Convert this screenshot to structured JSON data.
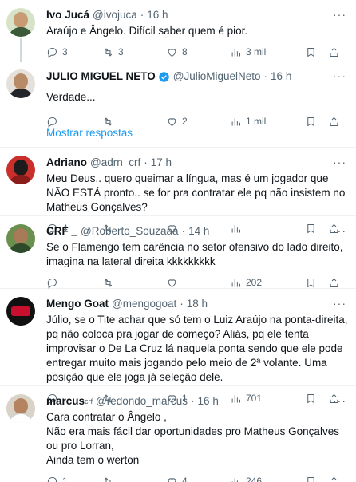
{
  "tweets": [
    {
      "name": "Ivo Jucá",
      "handle": "@ivojuca",
      "time": "16 h",
      "text": [
        "Araújo e Ângelo. Difícil saber quem é pior."
      ],
      "replies": "3",
      "retweets": "3",
      "likes": "8",
      "views": "3 mil"
    },
    {
      "name": "JULIO MIGUEL NETO",
      "handle": "@JulioMiguelNeto",
      "time": "16 h",
      "verified": true,
      "text": [
        "Verdade..."
      ],
      "replies": "",
      "retweets": "",
      "likes": "2",
      "views": "1 mil"
    },
    {
      "name": "Adriano",
      "handle": "@adrn_crf",
      "time": "17 h",
      "text": [
        "Meu Deus.. quero queimar a língua, mas é um jogador que NÃO ESTÁ pronto.. se for pra contratar ele pq não insistem no Matheus Gonçalves?"
      ],
      "replies": "4",
      "retweets": "",
      "likes": "",
      "views": ""
    },
    {
      "name": "CRF _",
      "handle": "@Roberto_Souzaaa",
      "time": "14 h",
      "text": [
        "Se o Flamengo tem carência no setor ofensivo do lado direito, imagina na lateral direita kkkkkkkkk"
      ],
      "replies": "",
      "retweets": "",
      "likes": "",
      "views": "202"
    },
    {
      "name": "Mengo Goat",
      "handle": "@mengogoat",
      "time": "18 h",
      "text": [
        "Júlio, se o Tite achar que só tem o Luiz Araújo na ponta-direita, pq não coloca pra jogar de começo? Aliás, pq ele tenta improvisar o De La Cruz lá naquela ponta sendo que ele pode entregar muito mais jogando pelo meio de 2ª volante. Uma posição que ele joga já seleção dele."
      ],
      "replies": "",
      "retweets": "",
      "likes": "1",
      "views": "701"
    },
    {
      "name": "marcus",
      "name_suffix": "crf",
      "handle": "@redondo_marcus",
      "time": "16 h",
      "text": [
        "Cara contratar o Ângelo ,",
        "Não era mais fácil dar oportunidades pro Matheus Gonçalves ou pro Lorran,",
        "Ainda tem o werton"
      ],
      "replies": "1",
      "retweets": "",
      "likes": "4",
      "views": "246"
    }
  ],
  "show_replies_label": "Mostrar respostas",
  "more_glyph": "···",
  "accent": "#1d9bf0"
}
